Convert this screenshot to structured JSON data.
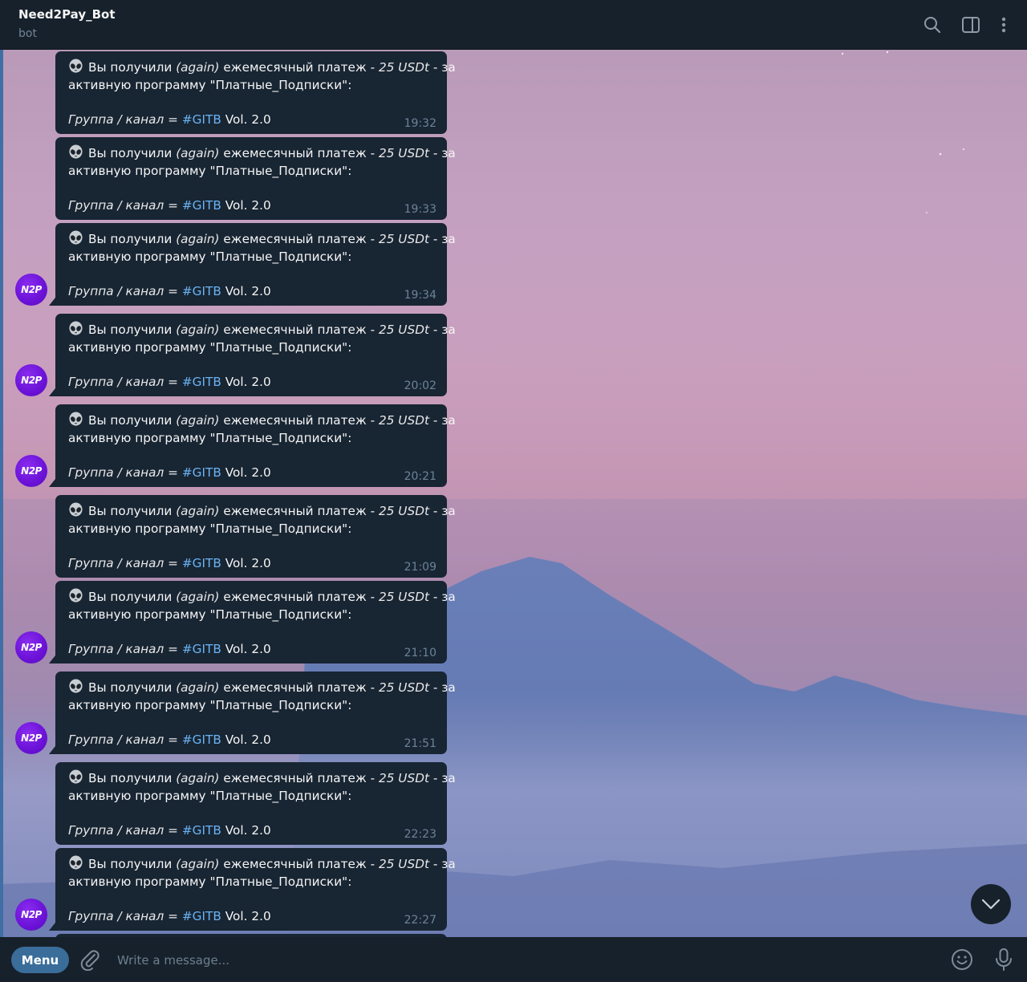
{
  "header": {
    "title": "Need2Pay_Bot",
    "subtitle": "bot"
  },
  "avatar_label": "N2P",
  "message_template": {
    "prefix": "Вы получили ",
    "again": "(again)",
    "mid": " ежемесячный платеж - ",
    "amount": "25 USDt",
    "suffix": " - за",
    "line2": "активную программу \"Платные_Подписки\":",
    "group_label": "Группа / канал = ",
    "hashtag": "#GITB",
    "version": " Vol. 2.0"
  },
  "messages": [
    {
      "time": "19:32",
      "avatar": false
    },
    {
      "time": "19:33",
      "avatar": false
    },
    {
      "time": "19:34",
      "avatar": true
    },
    {
      "time": "20:02",
      "avatar": true
    },
    {
      "time": "20:21",
      "avatar": true
    },
    {
      "time": "21:09",
      "avatar": false
    },
    {
      "time": "21:10",
      "avatar": true
    },
    {
      "time": "21:51",
      "avatar": true
    },
    {
      "time": "22:23",
      "avatar": false
    },
    {
      "time": "22:27",
      "avatar": true
    }
  ],
  "input": {
    "menu_label": "Menu",
    "placeholder": "Write a message..."
  },
  "icons": {
    "header": [
      "search-icon",
      "sidebar-toggle-icon",
      "more-vertical-icon"
    ],
    "message": "alien-emoji-icon",
    "scroll": "chevron-down-icon",
    "input": [
      "paperclip-icon",
      "emoji-icon",
      "microphone-icon"
    ]
  },
  "colors": {
    "panel": "#17212b",
    "bubble": "#182533",
    "link": "#6ab3f3",
    "menu_button": "#3a6d99",
    "avatar": "#6a12d6"
  }
}
